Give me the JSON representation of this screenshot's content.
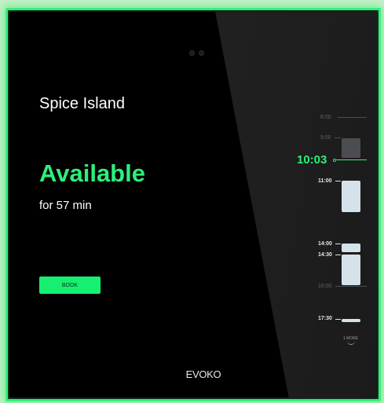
{
  "room": {
    "name": "Spice Island"
  },
  "status": {
    "label": "Available",
    "duration": "for 57 min"
  },
  "actions": {
    "book_label": "BOOK"
  },
  "brand": {
    "name": "EVOKO"
  },
  "timeline": {
    "now": "10:03",
    "labels": [
      "8:00",
      "9:00",
      "11:00",
      "14:00",
      "14:30",
      "16:00",
      "17:30"
    ],
    "more_label": "1 MORE"
  },
  "colors": {
    "accent": "#2cf07a",
    "frame_glow": "#36f07a",
    "booking_block": "#d6e2ea",
    "past_block": "#4b4d51"
  }
}
